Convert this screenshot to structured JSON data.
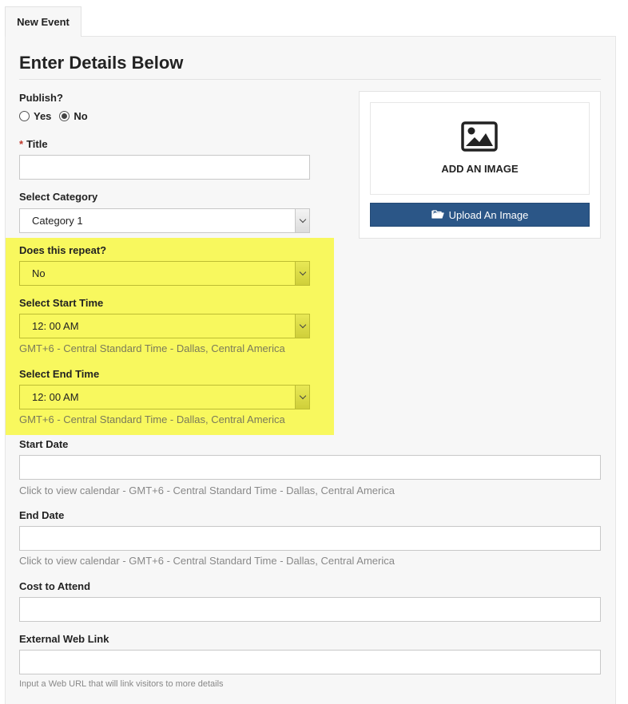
{
  "tab": {
    "label": "New Event"
  },
  "form": {
    "heading": "Enter Details Below",
    "publish": {
      "label": "Publish?",
      "options": [
        {
          "label": "Yes",
          "checked": false
        },
        {
          "label": "No",
          "checked": true
        }
      ]
    },
    "title": {
      "required_mark": "*",
      "label": "Title",
      "value": ""
    },
    "category": {
      "label": "Select Category",
      "value": "Category 1"
    },
    "repeat": {
      "label": "Does this repeat?",
      "value": "No"
    },
    "start_time": {
      "label": "Select Start Time",
      "value": "12: 00 AM",
      "help": "GMT+6 - Central Standard Time - Dallas, Central America"
    },
    "end_time": {
      "label": "Select End Time",
      "value": "12: 00 AM",
      "help": "GMT+6 - Central Standard Time - Dallas, Central America"
    },
    "start_date": {
      "label": "Start Date",
      "value": "",
      "help": "Click to view calendar - GMT+6 - Central Standard Time - Dallas, Central America"
    },
    "end_date": {
      "label": "End Date",
      "value": "",
      "help": "Click to view calendar - GMT+6 - Central Standard Time - Dallas, Central America"
    },
    "cost": {
      "label": "Cost to Attend",
      "value": ""
    },
    "web_link": {
      "label": "External Web Link",
      "value": "",
      "help": "Input a Web URL that will link visitors to more details"
    }
  },
  "image": {
    "add_label": "ADD AN IMAGE",
    "upload_label": "Upload An Image",
    "icon": "image-icon",
    "upload_icon": "folder-open-icon"
  },
  "colors": {
    "highlight": "#f8f85e",
    "upload_button": "#2b5687",
    "panel_background": "#f7f7f7",
    "required": "#c0392b"
  }
}
